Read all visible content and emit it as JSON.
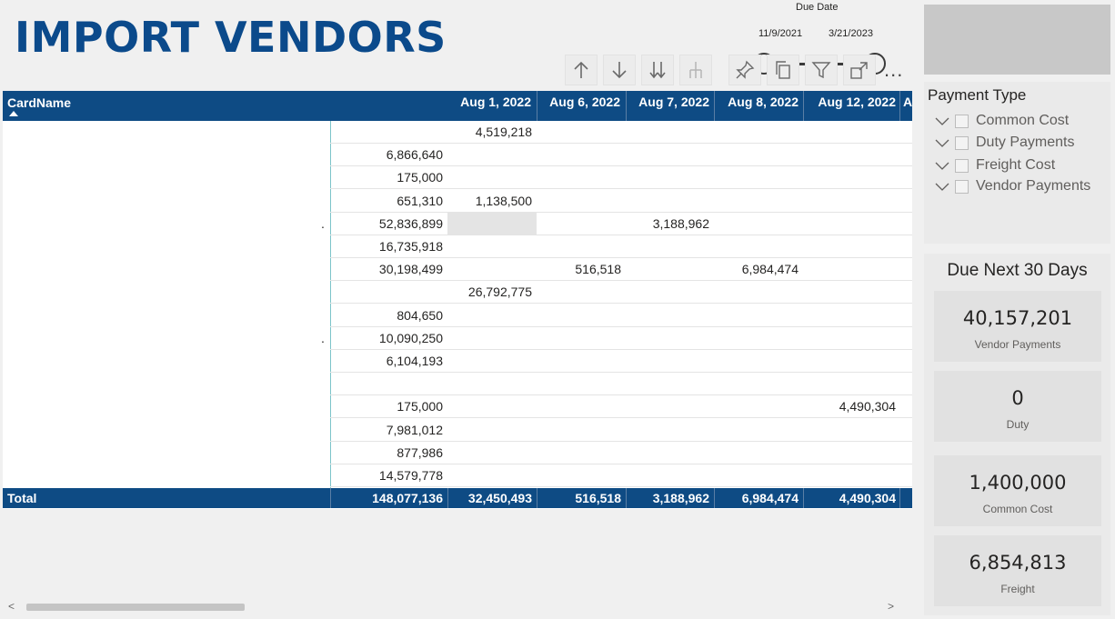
{
  "page": {
    "title": "IMPORT VENDORS"
  },
  "date_slicer": {
    "title": "Due Date",
    "start": "11/9/2021",
    "end": "3/21/2023"
  },
  "toolbar": {
    "more": "..."
  },
  "payment_type": {
    "title": "Payment Type",
    "items": [
      {
        "label": "Common Cost"
      },
      {
        "label": "Duty Payments"
      },
      {
        "label": "Freight Cost"
      },
      {
        "label": "Vendor Payments"
      }
    ]
  },
  "due_next": {
    "title": "Due Next 30 Days",
    "cards": [
      {
        "value": "40,157,201",
        "label": "Vendor Payments"
      },
      {
        "value": "0",
        "label": "Duty"
      },
      {
        "value": "1,400,000",
        "label": "Common Cost"
      },
      {
        "value": "6,854,813",
        "label": "Freight"
      }
    ]
  },
  "matrix": {
    "row_header": "CardName",
    "columns": [
      "Aug 1, 2022",
      "Aug 6, 2022",
      "Aug 7, 2022",
      "Aug 8, 2022",
      "Aug 12, 2022",
      "A"
    ],
    "rows": [
      {
        "dot": "",
        "total": "",
        "c1": "4,519,218",
        "c2": "",
        "c3": "",
        "c4": "",
        "c5": ""
      },
      {
        "dot": "",
        "total": "6,866,640",
        "c1": "",
        "c2": "",
        "c3": "",
        "c4": "",
        "c5": ""
      },
      {
        "dot": "",
        "total": "175,000",
        "c1": "",
        "c2": "",
        "c3": "",
        "c4": "",
        "c5": ""
      },
      {
        "dot": "",
        "total": "651,310",
        "c1": "1,138,500",
        "c2": "",
        "c3": "",
        "c4": "",
        "c5": ""
      },
      {
        "dot": ".",
        "total": "52,836,899",
        "c1": "",
        "c2": "",
        "c3": "3,188,962",
        "c4": "",
        "c5": ""
      },
      {
        "dot": "",
        "total": "16,735,918",
        "c1": "",
        "c2": "",
        "c3": "",
        "c4": "",
        "c5": ""
      },
      {
        "dot": "",
        "total": "30,198,499",
        "c1": "",
        "c2": "516,518",
        "c3": "",
        "c4": "6,984,474",
        "c5": ""
      },
      {
        "dot": "",
        "total": "",
        "c1": "26,792,775",
        "c2": "",
        "c3": "",
        "c4": "",
        "c5": ""
      },
      {
        "dot": "",
        "total": "804,650",
        "c1": "",
        "c2": "",
        "c3": "",
        "c4": "",
        "c5": ""
      },
      {
        "dot": ".",
        "total": "10,090,250",
        "c1": "",
        "c2": "",
        "c3": "",
        "c4": "",
        "c5": ""
      },
      {
        "dot": "",
        "total": "6,104,193",
        "c1": "",
        "c2": "",
        "c3": "",
        "c4": "",
        "c5": ""
      },
      {
        "dot": "",
        "total": "",
        "c1": "",
        "c2": "",
        "c3": "",
        "c4": "",
        "c5": ""
      },
      {
        "dot": "",
        "total": "175,000",
        "c1": "",
        "c2": "",
        "c3": "",
        "c4": "",
        "c5": "4,490,304"
      },
      {
        "dot": "",
        "total": "7,981,012",
        "c1": "",
        "c2": "",
        "c3": "",
        "c4": "",
        "c5": ""
      },
      {
        "dot": "",
        "total": "877,986",
        "c1": "",
        "c2": "",
        "c3": "",
        "c4": "",
        "c5": ""
      },
      {
        "dot": "",
        "total": "14,579,778",
        "c1": "",
        "c2": "",
        "c3": "",
        "c4": "",
        "c5": ""
      }
    ],
    "total_row": {
      "label": "Total",
      "total": "148,077,136",
      "c1": "32,450,493",
      "c2": "516,518",
      "c3": "3,188,962",
      "c4": "6,984,474",
      "c5": "4,490,304"
    }
  },
  "scrollbar": {
    "left_arrow": "<",
    "right_arrow": ">"
  }
}
